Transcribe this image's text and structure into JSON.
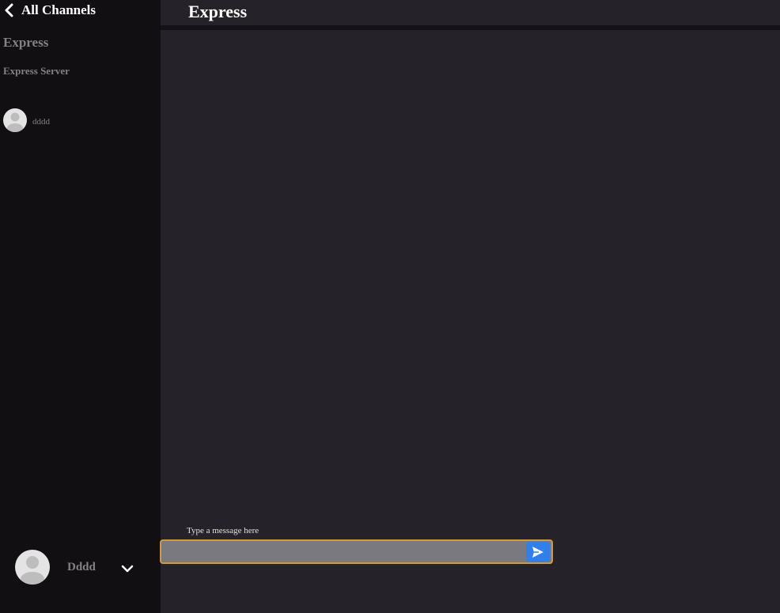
{
  "sidebar": {
    "back_label": "All Channels",
    "channel_name": "Express",
    "channel_description": "Express Server",
    "members": [
      {
        "name": "dddd"
      }
    ],
    "profile": {
      "name": "Dddd"
    }
  },
  "header": {
    "title": "Express"
  },
  "composer": {
    "label": "Type a message here",
    "value": "",
    "placeholder": ""
  },
  "icons": {
    "back": "chevron-left-icon",
    "send": "send-icon",
    "dropdown": "chevron-down-icon",
    "avatar": "user-avatar-icon"
  },
  "colors": {
    "sidebar_bg": "#120f13",
    "main_bg": "#252329",
    "accent": "#2f80ed",
    "input_border": "#d19a3a",
    "input_bg": "#7a7980"
  }
}
